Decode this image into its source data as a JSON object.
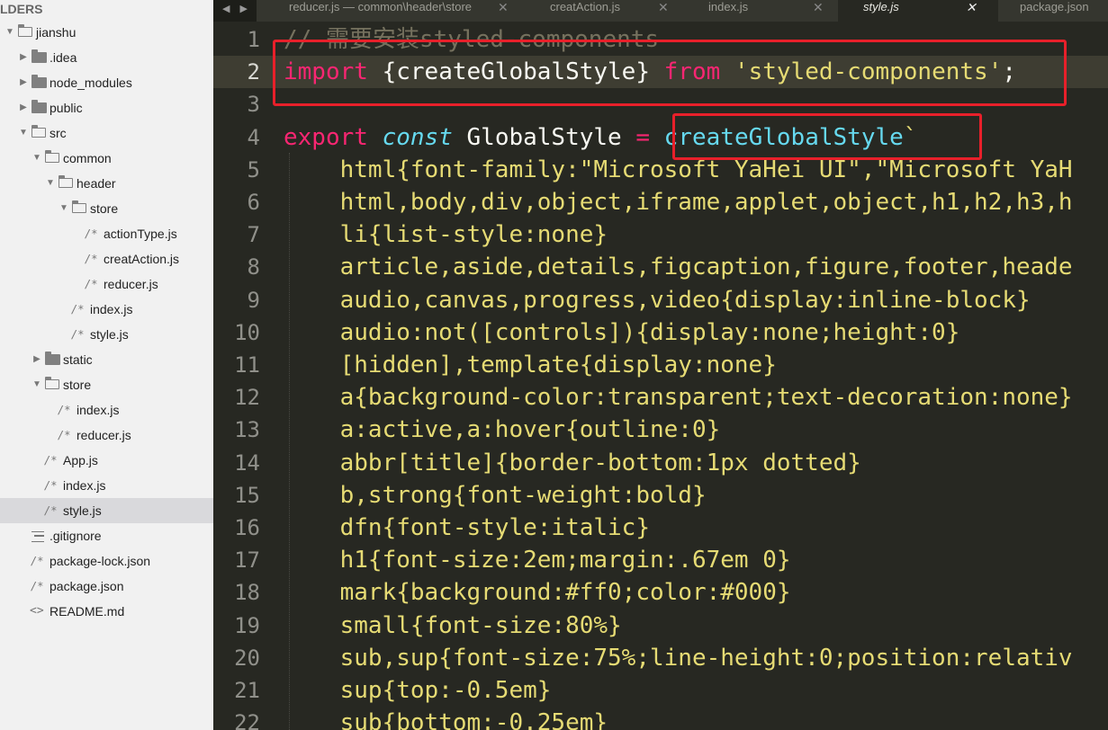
{
  "sidebar": {
    "header": "LDERS",
    "items": [
      {
        "label": "jianshu",
        "kind": "folder-open",
        "depth": 0
      },
      {
        "label": ".idea",
        "kind": "folder",
        "depth": 1
      },
      {
        "label": "node_modules",
        "kind": "folder",
        "depth": 1
      },
      {
        "label": "public",
        "kind": "folder",
        "depth": 1
      },
      {
        "label": "src",
        "kind": "folder-open",
        "depth": 1
      },
      {
        "label": "common",
        "kind": "folder-open",
        "depth": 2
      },
      {
        "label": "header",
        "kind": "folder-open",
        "depth": 3
      },
      {
        "label": "store",
        "kind": "folder-open",
        "depth": 4
      },
      {
        "label": "actionType.js",
        "kind": "js",
        "depth": 5
      },
      {
        "label": "creatAction.js",
        "kind": "js",
        "depth": 5
      },
      {
        "label": "reducer.js",
        "kind": "js",
        "depth": 5
      },
      {
        "label": "index.js",
        "kind": "js",
        "depth": 4
      },
      {
        "label": "style.js",
        "kind": "js",
        "depth": 4
      },
      {
        "label": "static",
        "kind": "folder",
        "depth": 2
      },
      {
        "label": "store",
        "kind": "folder-open",
        "depth": 2
      },
      {
        "label": "index.js",
        "kind": "js",
        "depth": 3
      },
      {
        "label": "reducer.js",
        "kind": "js",
        "depth": 3
      },
      {
        "label": "App.js",
        "kind": "js",
        "depth": 2
      },
      {
        "label": "index.js",
        "kind": "js",
        "depth": 2
      },
      {
        "label": "style.js",
        "kind": "js",
        "depth": 2,
        "selected": true
      },
      {
        "label": ".gitignore",
        "kind": "text",
        "depth": 1
      },
      {
        "label": "package-lock.json",
        "kind": "js",
        "depth": 1
      },
      {
        "label": "package.json",
        "kind": "js",
        "depth": 1
      },
      {
        "label": "README.md",
        "kind": "code",
        "depth": 1
      }
    ]
  },
  "tabs": {
    "nav": "◀ ▶",
    "items": [
      {
        "label": "reducer.js — common\\header\\store",
        "close": "✕"
      },
      {
        "label": "creatAction.js",
        "close": "✕"
      },
      {
        "label": "index.js",
        "close": "✕"
      },
      {
        "label": "style.js",
        "close": "✕",
        "active": true
      },
      {
        "label": "package.json",
        "close": ""
      }
    ]
  },
  "editor": {
    "current_line": 2,
    "lines": [
      {
        "n": "1",
        "code": "// 需要安装styled-components"
      },
      {
        "n": "2",
        "code": "import {createGlobalStyle} from 'styled-components';"
      },
      {
        "n": "3",
        "code": ""
      },
      {
        "n": "4",
        "code": "export const GlobalStyle = createGlobalStyle`"
      },
      {
        "n": "5",
        "code": "    html{font-family:\"Microsoft YaHei UI\",\"Microsoft YaH"
      },
      {
        "n": "6",
        "code": "    html,body,div,object,iframe,applet,object,h1,h2,h3,h"
      },
      {
        "n": "7",
        "code": "    li{list-style:none}"
      },
      {
        "n": "8",
        "code": "    article,aside,details,figcaption,figure,footer,heade"
      },
      {
        "n": "9",
        "code": "    audio,canvas,progress,video{display:inline-block}"
      },
      {
        "n": "10",
        "code": "    audio:not([controls]){display:none;height:0}"
      },
      {
        "n": "11",
        "code": "    [hidden],template{display:none}"
      },
      {
        "n": "12",
        "code": "    a{background-color:transparent;text-decoration:none}"
      },
      {
        "n": "13",
        "code": "    a:active,a:hover{outline:0}"
      },
      {
        "n": "14",
        "code": "    abbr[title]{border-bottom:1px dotted}"
      },
      {
        "n": "15",
        "code": "    b,strong{font-weight:bold}"
      },
      {
        "n": "16",
        "code": "    dfn{font-style:italic}"
      },
      {
        "n": "17",
        "code": "    h1{font-size:2em;margin:.67em 0}"
      },
      {
        "n": "18",
        "code": "    mark{background:#ff0;color:#000}"
      },
      {
        "n": "19",
        "code": "    small{font-size:80%}"
      },
      {
        "n": "20",
        "code": "    sub,sup{font-size:75%;line-height:0;position:relativ"
      },
      {
        "n": "21",
        "code": "    sup{top:-0.5em}"
      },
      {
        "n": "22",
        "code": "    sub{bottom:-0.25em}"
      }
    ]
  },
  "colors": {
    "keyword": "#f92672",
    "string": "#e6db74",
    "function": "#66d9ef",
    "comment": "#75715e",
    "annotation": "#e8202a"
  }
}
